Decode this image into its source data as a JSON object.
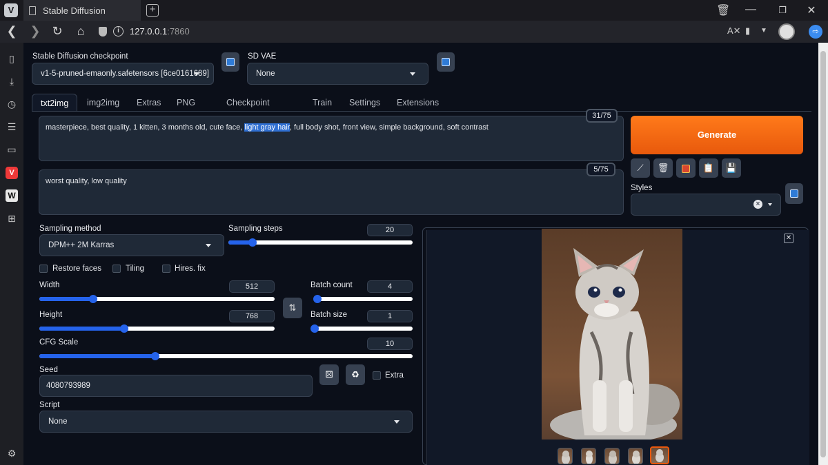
{
  "browser": {
    "logo": "V",
    "tab_title": "Stable Diffusion",
    "url_host": "127.0.0.1",
    "url_port": ":7860",
    "icons": [
      "bookmark-icon",
      "download-icon",
      "history-icon",
      "notes-icon",
      "window-icon",
      "vivaldi-icon",
      "wikipedia-icon",
      "add-panel-icon",
      "settings-icon"
    ]
  },
  "app": {
    "checkpoint": {
      "label": "Stable Diffusion checkpoint",
      "value": "v1-5-pruned-emaonly.safetensors [6ce0161689]"
    },
    "vae": {
      "label": "SD VAE",
      "value": "None"
    },
    "tabs": [
      "txt2img",
      "img2img",
      "Extras",
      "PNG Info",
      "Checkpoint Merger",
      "Train",
      "Settings",
      "Extensions"
    ],
    "prompt": {
      "before": "masterpiece, best quality, 1 kitten, 3 months old, cute face, ",
      "highlight": "light gray hair",
      "after": ", full body shot, front view, simple background, soft contrast",
      "counter": "31/75"
    },
    "negative_prompt": {
      "text": "worst quality, low quality",
      "counter": "5/75"
    },
    "generate_label": "Generate",
    "styles_label": "Styles",
    "styles_clear": "×",
    "sampling_method": {
      "label": "Sampling method",
      "value": "DPM++ 2M Karras"
    },
    "sampling_steps": {
      "label": "Sampling steps",
      "value": "20",
      "fraction": 0.13
    },
    "checkboxes": {
      "restore_faces": "Restore faces",
      "tiling": "Tiling",
      "hires_fix": "Hires. fix"
    },
    "width": {
      "label": "Width",
      "value": "512",
      "fraction": 0.23
    },
    "height": {
      "label": "Height",
      "value": "768",
      "fraction": 0.36
    },
    "batch_count": {
      "label": "Batch count",
      "value": "4",
      "fraction": 0.03
    },
    "batch_size": {
      "label": "Batch size",
      "value": "1",
      "fraction": 0.0
    },
    "cfg_scale": {
      "label": "CFG Scale",
      "value": "10",
      "fraction": 0.31
    },
    "seed": {
      "label": "Seed",
      "value": "4080793989",
      "extra_label": "Extra"
    },
    "script": {
      "label": "Script",
      "value": "None"
    }
  }
}
